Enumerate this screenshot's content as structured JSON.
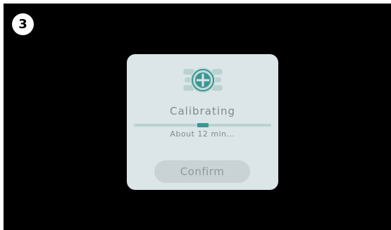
{
  "step_badge": {
    "label": "3"
  },
  "dialog": {
    "icon": "calibration-crosshair-icon",
    "title": "Calibrating",
    "progress_fraction": 0.5,
    "subtext": "About 12 min...",
    "confirm_label": "Confirm"
  },
  "colors": {
    "background": "#000000",
    "dialog_bg": "#dce5e7",
    "accent": "#3b9793",
    "text": "#7f8b8d",
    "button_bg": "#c9d3d6"
  }
}
